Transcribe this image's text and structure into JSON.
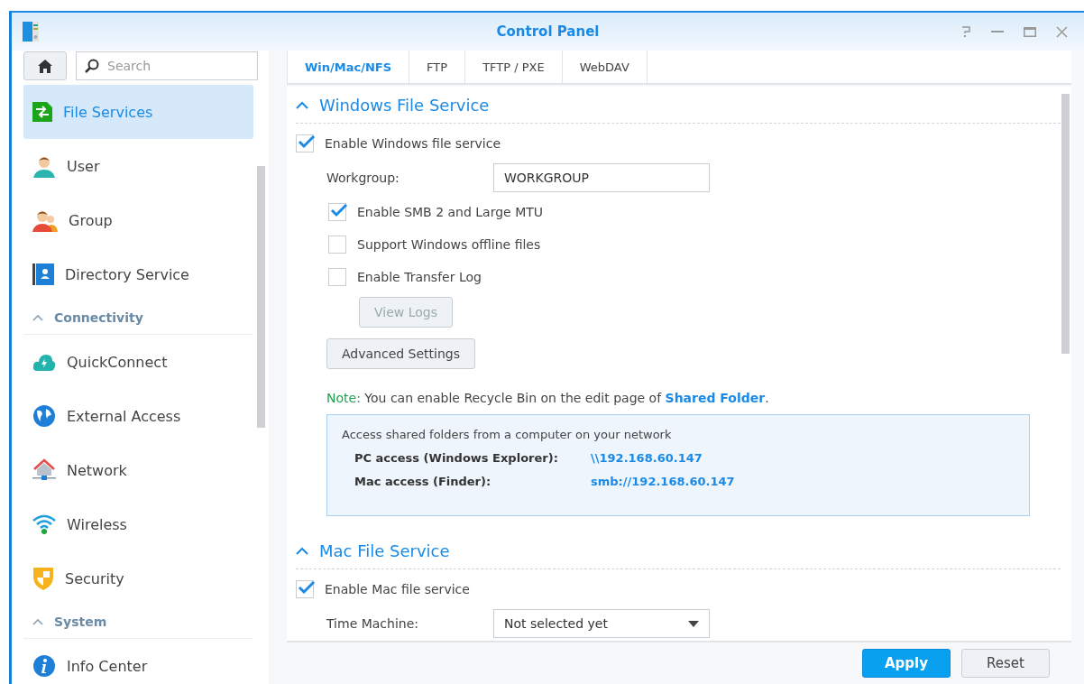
{
  "window": {
    "title": "Control Panel"
  },
  "sidebar": {
    "search": {
      "placeholder": "Search"
    },
    "items": [
      {
        "kind": "item",
        "label": "File Services",
        "selected": true
      },
      {
        "kind": "item",
        "label": "User",
        "selected": false
      },
      {
        "kind": "item",
        "label": "Group",
        "selected": false
      },
      {
        "kind": "item",
        "label": "Directory Service",
        "selected": false
      },
      {
        "kind": "header",
        "label": "Connectivity",
        "expanded": true
      },
      {
        "kind": "item",
        "label": "QuickConnect",
        "selected": false
      },
      {
        "kind": "item",
        "label": "External Access",
        "selected": false
      },
      {
        "kind": "item",
        "label": "Network",
        "selected": false
      },
      {
        "kind": "item",
        "label": "Wireless",
        "selected": false
      },
      {
        "kind": "item",
        "label": "Security",
        "selected": false
      },
      {
        "kind": "header",
        "label": "System",
        "expanded": true
      },
      {
        "kind": "item",
        "label": "Info Center",
        "selected": false
      }
    ]
  },
  "tabs": [
    {
      "label": "Win/Mac/NFS",
      "selected": true
    },
    {
      "label": "FTP",
      "selected": false
    },
    {
      "label": "TFTP / PXE",
      "selected": false
    },
    {
      "label": "WebDAV",
      "selected": false
    }
  ],
  "windows_file_service": {
    "title": "Windows File Service",
    "expanded": true,
    "enable": {
      "label": "Enable Windows file service",
      "checked": true
    },
    "workgroup": {
      "label": "Workgroup:",
      "value": "WORKGROUP"
    },
    "options": [
      {
        "label": "Enable SMB 2 and Large MTU",
        "checked": true
      },
      {
        "label": "Support Windows offline files",
        "checked": false
      },
      {
        "label": "Enable Transfer Log",
        "checked": false
      }
    ],
    "view_logs_button": {
      "label": "View Logs",
      "disabled": true
    },
    "advanced_button": {
      "label": "Advanced Settings"
    },
    "note": {
      "prefix": "Note:",
      "text": " You can enable Recycle Bin on the edit page of ",
      "link": "Shared Folder",
      "suffix": "."
    },
    "access": {
      "title": "Access shared folders from a computer on your network",
      "rows": [
        {
          "label": "PC access (Windows Explorer):",
          "value": "\\\\192.168.60.147"
        },
        {
          "label": "Mac access (Finder):",
          "value": "smb://192.168.60.147"
        }
      ]
    }
  },
  "mac_file_service": {
    "title": "Mac File Service",
    "expanded": true,
    "enable": {
      "label": "Enable Mac file service",
      "checked": true
    },
    "time_machine": {
      "label": "Time Machine:",
      "value": "Not selected yet"
    }
  },
  "buttons": [
    {
      "kind": "primary",
      "label": "Apply"
    },
    {
      "kind": "secondary",
      "label": "Reset"
    }
  ]
}
